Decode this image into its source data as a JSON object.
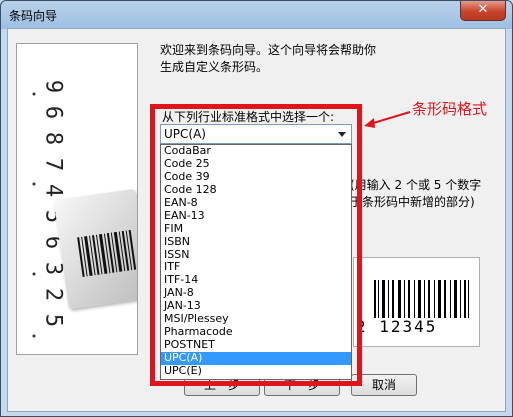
{
  "window": {
    "title": "条码向导",
    "close_glyph": "✕"
  },
  "intro_text": [
    "欢迎来到条码向导。这个向导将会帮助你",
    "生成自定义条形码。"
  ],
  "combo": {
    "label": "从下列行业标准格式中选择一个:",
    "value": "UPC(A)",
    "options": [
      "CodaBar",
      "Code 25",
      "Code 39",
      "Code 128",
      "EAN-8",
      "EAN-13",
      "FIM",
      "ISBN",
      "ISSN",
      "ITF",
      "ITF-14",
      "JAN-8",
      "JAN-13",
      "MSI/Plessey",
      "Pharmacode",
      "POSTNET",
      "UPC(A)",
      "UPC(E)"
    ],
    "selected_option": "UPC(A)"
  },
  "hint_text": [
    "(用输入 2 个或 5 个数字",
    "于条形码中新增的部分)"
  ],
  "sample_barcode_digits": "2  12345",
  "side_image_digits": [
    "9",
    "6",
    "8",
    "7",
    "4",
    "5",
    "6",
    "3",
    "2",
    "5"
  ],
  "buttons": {
    "back": "上一步",
    "next": "下一步",
    "cancel": "取消"
  },
  "annotation": {
    "text": "条形码格式",
    "color": "#e0141b"
  },
  "colors": {
    "highlight_box": "#e0141b",
    "selection": "#3399ff"
  }
}
